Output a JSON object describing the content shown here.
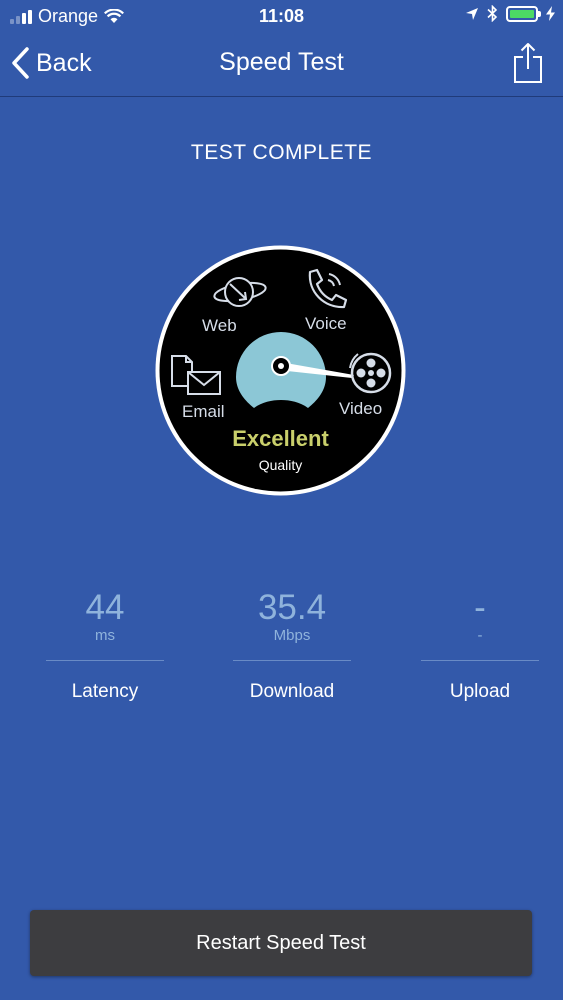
{
  "status_bar": {
    "carrier": "Orange",
    "time": "11:08",
    "icons": [
      "signal-icon",
      "wifi-icon",
      "location-arrow-icon",
      "bluetooth-icon",
      "battery-icon",
      "charging-icon"
    ]
  },
  "nav": {
    "back_label": "Back",
    "title": "Speed Test",
    "share_icon": "share-icon"
  },
  "status_heading": "TEST COMPLETE",
  "gauge": {
    "categories": [
      "Web",
      "Voice",
      "Email",
      "Video"
    ],
    "quality_rating": "Excellent",
    "quality_label": "Quality",
    "rating_color": "#c9cf6b",
    "dial_color": "#8cc7d6"
  },
  "metrics": [
    {
      "value": "44",
      "unit": "ms",
      "label": "Latency"
    },
    {
      "value": "35.4",
      "unit": "Mbps",
      "label": "Download"
    },
    {
      "value": "-",
      "unit": "-",
      "label": "Upload"
    }
  ],
  "restart_label": "Restart Speed Test",
  "colors": {
    "background": "#3359aa",
    "metric_value": "#8fb3dc",
    "button": "#3d3d40",
    "battery": "#4cd964"
  }
}
